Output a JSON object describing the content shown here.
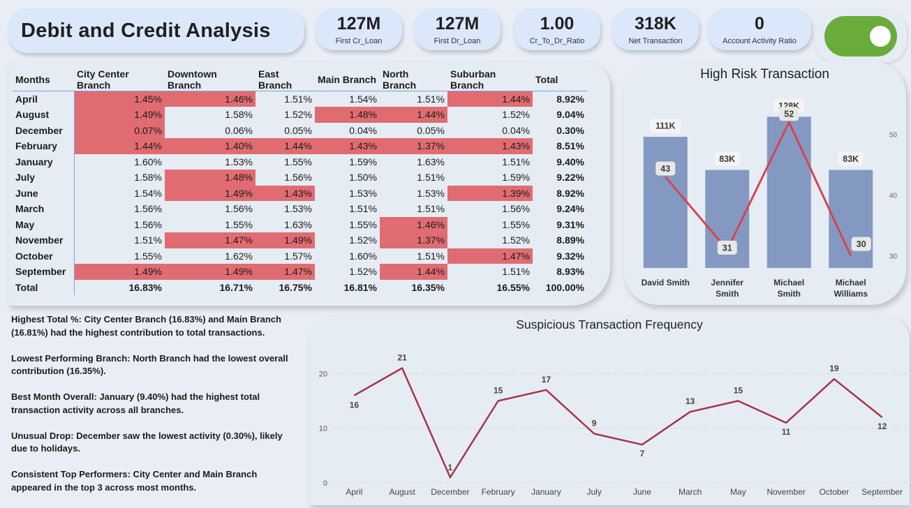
{
  "title": "Debit and Credit Analysis",
  "kpis": [
    {
      "value": "127M",
      "label": "First Cr_Loan"
    },
    {
      "value": "127M",
      "label": "First Dr_Loan"
    },
    {
      "value": "1.00",
      "label": "Cr_To_Dr_Ratio"
    },
    {
      "value": "318K",
      "label": "Net Transaction"
    },
    {
      "value": "0",
      "label": "Account Activity Ratio"
    }
  ],
  "toggle": {
    "state": "on",
    "color": "#6aac3b"
  },
  "matrix": {
    "headers": [
      "Months",
      "City Center Branch",
      "Downtown Branch",
      "East Branch",
      "Main Branch",
      "North Branch",
      "Suburban Branch",
      "Total"
    ],
    "highlight_color": "#e06c72",
    "rows": [
      {
        "month": "April",
        "values": [
          "1.45%",
          "1.46%",
          "1.51%",
          "1.54%",
          "1.51%",
          "1.44%"
        ],
        "total": "8.92%",
        "hl": [
          1,
          1,
          0,
          0,
          0,
          1
        ]
      },
      {
        "month": "August",
        "values": [
          "1.49%",
          "1.58%",
          "1.52%",
          "1.48%",
          "1.44%",
          "1.52%"
        ],
        "total": "9.04%",
        "hl": [
          1,
          0,
          0,
          1,
          1,
          0
        ]
      },
      {
        "month": "December",
        "values": [
          "0.07%",
          "0.06%",
          "0.05%",
          "0.04%",
          "0.05%",
          "0.04%"
        ],
        "total": "0.30%",
        "hl": [
          1,
          0,
          0,
          0,
          0,
          0
        ]
      },
      {
        "month": "February",
        "values": [
          "1.44%",
          "1.40%",
          "1.44%",
          "1.43%",
          "1.37%",
          "1.43%"
        ],
        "total": "8.51%",
        "hl": [
          1,
          1,
          1,
          1,
          1,
          1
        ]
      },
      {
        "month": "January",
        "values": [
          "1.60%",
          "1.53%",
          "1.55%",
          "1.59%",
          "1.63%",
          "1.51%"
        ],
        "total": "9.40%",
        "hl": [
          0,
          0,
          0,
          0,
          0,
          0
        ]
      },
      {
        "month": "July",
        "values": [
          "1.58%",
          "1.48%",
          "1.56%",
          "1.50%",
          "1.51%",
          "1.59%"
        ],
        "total": "9.22%",
        "hl": [
          0,
          1,
          0,
          0,
          0,
          0
        ]
      },
      {
        "month": "June",
        "values": [
          "1.54%",
          "1.49%",
          "1.43%",
          "1.53%",
          "1.53%",
          "1.39%"
        ],
        "total": "8.92%",
        "hl": [
          0,
          1,
          1,
          0,
          0,
          1
        ]
      },
      {
        "month": "March",
        "values": [
          "1.56%",
          "1.56%",
          "1.53%",
          "1.51%",
          "1.51%",
          "1.56%"
        ],
        "total": "9.24%",
        "hl": [
          0,
          0,
          0,
          0,
          0,
          0
        ]
      },
      {
        "month": "May",
        "values": [
          "1.56%",
          "1.55%",
          "1.63%",
          "1.55%",
          "1.46%",
          "1.55%"
        ],
        "total": "9.31%",
        "hl": [
          0,
          0,
          0,
          0,
          1,
          0
        ]
      },
      {
        "month": "November",
        "values": [
          "1.51%",
          "1.47%",
          "1.49%",
          "1.52%",
          "1.37%",
          "1.52%"
        ],
        "total": "8.89%",
        "hl": [
          0,
          1,
          1,
          0,
          1,
          0
        ]
      },
      {
        "month": "October",
        "values": [
          "1.55%",
          "1.62%",
          "1.57%",
          "1.60%",
          "1.51%",
          "1.47%"
        ],
        "total": "9.32%",
        "hl": [
          0,
          0,
          0,
          0,
          0,
          1
        ]
      },
      {
        "month": "September",
        "values": [
          "1.49%",
          "1.49%",
          "1.47%",
          "1.52%",
          "1.44%",
          "1.51%"
        ],
        "total": "8.93%",
        "hl": [
          1,
          1,
          1,
          0,
          1,
          0
        ]
      }
    ],
    "total_row": {
      "label": "Total",
      "values": [
        "16.83%",
        "16.71%",
        "16.75%",
        "16.81%",
        "16.35%",
        "16.55%"
      ],
      "total": "100.00%"
    }
  },
  "notes": [
    "Highest Total %: City Center Branch (16.83%) and Main Branch (16.81%) had the highest contribution to total transactions.",
    "Lowest Performing Branch: North Branch had the lowest overall contribution (16.35%).",
    "Best Month Overall: January (9.40%) had the highest total transaction activity across all branches.",
    "Unusual Drop: December saw the lowest activity (0.30%), likely due to holidays.",
    "Consistent Top Performers: City Center and Main Branch appeared in the top 3 across most months."
  ],
  "chart_data": [
    {
      "type": "bar",
      "title": "High Risk Transaction",
      "categories": [
        "David Smith",
        "Jennifer Smith",
        "Michael Smith",
        "Michael Williams"
      ],
      "category_lines": [
        [
          "David Smith"
        ],
        [
          "Jennifer",
          "Smith"
        ],
        [
          "Michael",
          "Smith"
        ],
        [
          "Michael",
          "Williams"
        ]
      ],
      "series": [
        {
          "type": "bar",
          "values": [
            111000,
            83000,
            128000,
            83000
          ],
          "labels": [
            "111K",
            "83K",
            "128K",
            "83K"
          ],
          "color": "#8499c1"
        },
        {
          "type": "line",
          "values": [
            43,
            31,
            52,
            30
          ],
          "labels": [
            "43",
            "31",
            "52",
            "30"
          ],
          "color": "#d44451",
          "axis": "right"
        }
      ],
      "bar_ylim": [
        0,
        140000
      ],
      "right_axis": {
        "ticks": [
          "30",
          "40",
          "50"
        ],
        "ylim": [
          28,
          55
        ]
      }
    },
    {
      "type": "line",
      "title": "Suspicious Transaction Frequency",
      "categories": [
        "April",
        "August",
        "December",
        "February",
        "January",
        "July",
        "June",
        "March",
        "May",
        "November",
        "October",
        "September"
      ],
      "values": [
        16,
        21,
        1,
        15,
        17,
        9,
        7,
        13,
        15,
        11,
        19,
        12
      ],
      "labels": [
        "16",
        "21",
        "1",
        "15",
        "17",
        "9",
        "7",
        "13",
        "15",
        "11",
        "19",
        "12"
      ],
      "y_ticks": [
        "0",
        "10",
        "20"
      ],
      "ylim": [
        0,
        24
      ],
      "color": "#a73445",
      "grid": true
    }
  ]
}
